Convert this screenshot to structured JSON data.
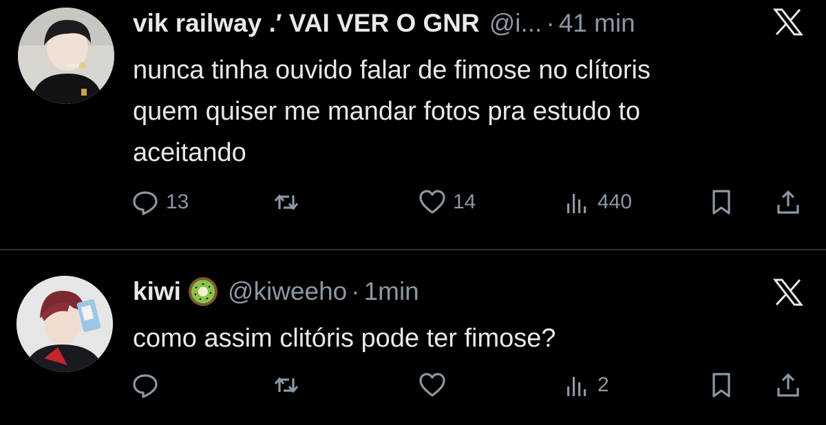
{
  "tweets": [
    {
      "name": "vik railway .′ VAI VER O GNR",
      "handle": "@i...",
      "separator": "·",
      "time": "41 min",
      "text_lines": [
        "nunca tinha ouvido falar de fimose no clítoris",
        "quem quiser me mandar fotos pra estudo to",
        "aceitando"
      ],
      "replies": "13",
      "retweets": "",
      "likes": "14",
      "views": "440"
    },
    {
      "name": "kiwi",
      "badge_icon": "kiwi-fruit-emoji",
      "handle": "@kiweeho",
      "separator": "·",
      "time": "1min",
      "text_lines": [
        "como assim clitóris pode ter fimose?"
      ],
      "replies": "",
      "retweets": "",
      "likes": "",
      "views": "2"
    }
  ],
  "icons": {
    "brand": "x-logo-icon",
    "reply": "reply-icon",
    "retweet": "retweet-icon",
    "like": "heart-icon",
    "views": "views-icon",
    "bookmark": "bookmark-icon",
    "share": "share-icon"
  },
  "colors": {
    "background": "#000000",
    "text": "#e7e9ea",
    "secondary": "#8b98a5",
    "divider": "#2f3336"
  }
}
